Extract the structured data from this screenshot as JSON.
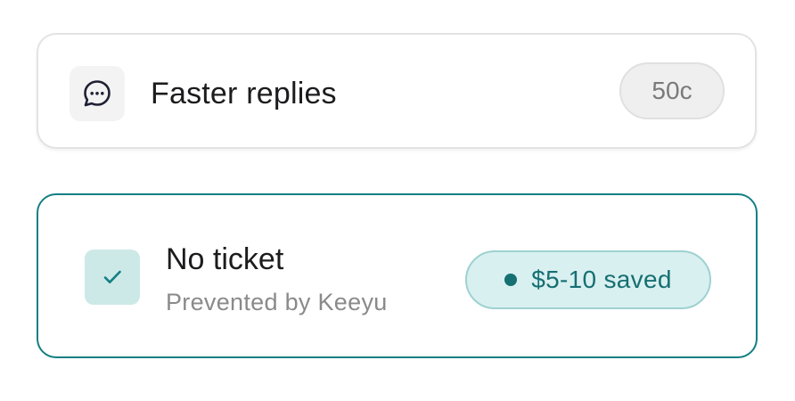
{
  "cards": [
    {
      "icon": "chat-bubble-icon",
      "title": "Faster replies",
      "badge": "50c"
    },
    {
      "icon": "check-icon",
      "title": "No ticket",
      "subtitle": "Prevented by Keeyu",
      "badge": "$5-10 saved"
    }
  ],
  "colors": {
    "accent": "#137f83",
    "accent_light": "#d9f0f0",
    "neutral_badge": "#efefef"
  }
}
